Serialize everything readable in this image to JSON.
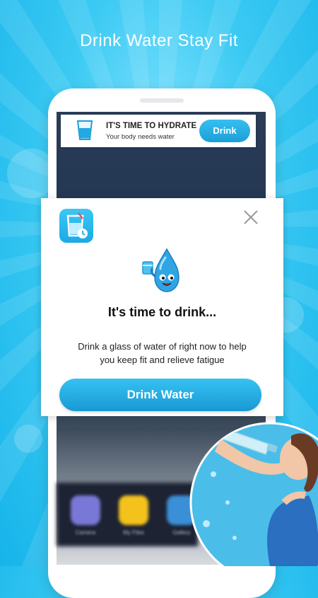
{
  "headline": "Drink Water Stay Fit",
  "notification": {
    "title": "IT'S TIME TO HYDRATE",
    "subtitle": "Your body needs water",
    "button_label": "Drink",
    "icon": "water-glass-icon"
  },
  "dialog": {
    "app_icon": "water-glass-clock-icon",
    "close_icon": "close-icon",
    "title": "It's time to drink...",
    "body_line1": "Drink a glass of water of right now to help",
    "body_line2": "you keep fit and relieve fatigue",
    "button_label": "Drink Water"
  },
  "dock": {
    "apps": [
      {
        "label": "Camera",
        "icon": "camera-app-icon",
        "color": "#7a78d6"
      },
      {
        "label": "My Files",
        "icon": "files-app-icon",
        "color": "#f4c21c"
      },
      {
        "label": "Gallery",
        "icon": "gallery-app-icon",
        "color": "#3b8fd6"
      }
    ]
  },
  "colors": {
    "background": "#3ccaf3",
    "accent": "#1ea6df",
    "dialog_bg": "#ffffff"
  }
}
